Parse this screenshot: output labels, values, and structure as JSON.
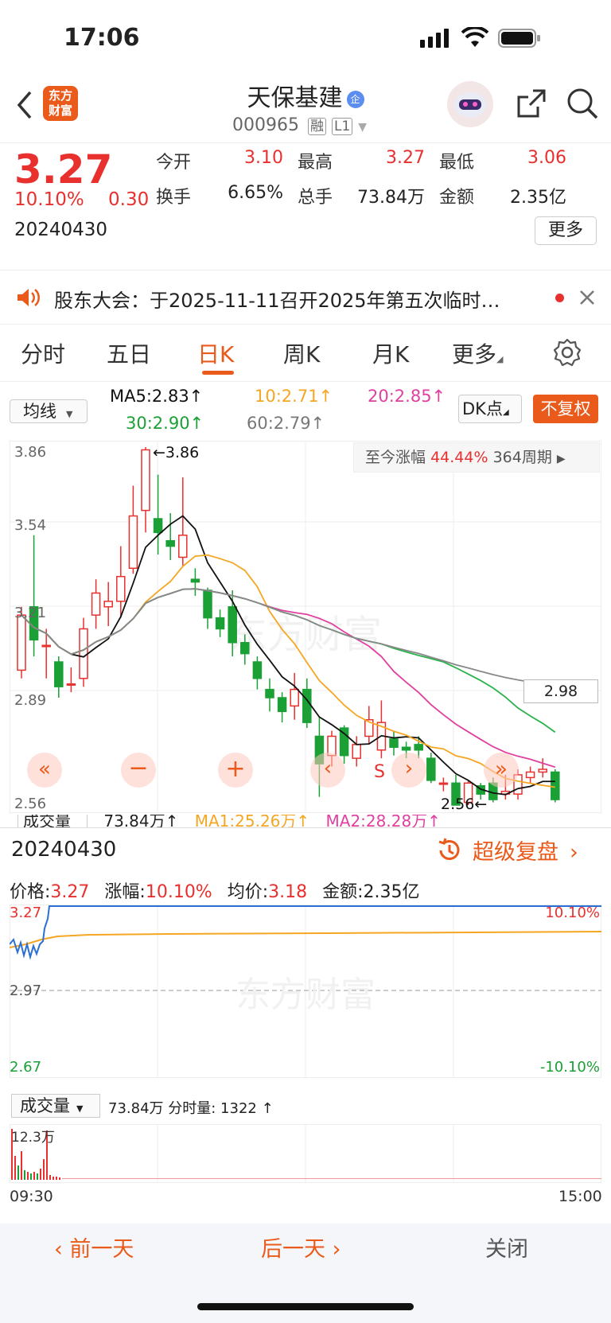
{
  "status": {
    "time": "17:06"
  },
  "header": {
    "logo_text": "东方\n财富",
    "title": "天保基建",
    "code": "000965",
    "badge1": "融",
    "badge2": "L1",
    "title_badge": "企"
  },
  "quote": {
    "price": "3.27",
    "change_pct": "10.10%",
    "change_abs": "0.30",
    "date": "20240430",
    "stats": [
      {
        "label": "今开",
        "value": "3.10",
        "color": "#e8302f"
      },
      {
        "label": "最高",
        "value": "3.27",
        "color": "#e8302f"
      },
      {
        "label": "最低",
        "value": "3.06",
        "color": "#e8302f"
      },
      {
        "label": "换手",
        "value": "6.65%",
        "color": "#222"
      },
      {
        "label": "总手",
        "value": "73.84万",
        "color": "#222"
      },
      {
        "label": "金额",
        "value": "2.35亿",
        "color": "#222"
      }
    ],
    "more_label": "更多"
  },
  "notice": {
    "text": "股东大会：于2025-11-11召开2025年第五次临时…"
  },
  "tabs": [
    "分时",
    "五日",
    "日K",
    "周K",
    "月K",
    "更多"
  ],
  "active_tab": "日K",
  "ma_row": {
    "selector": "均线",
    "ma5": "MA5:2.83↑",
    "ma10": "10:2.71↑",
    "ma20": "20:2.85↑",
    "ma30": "30:2.90↑",
    "ma60": "60:2.79↑",
    "dk_label": "DK点",
    "fq_label": "不复权"
  },
  "kchart": {
    "y_labels": [
      "3.86",
      "3.54",
      "3.21",
      "2.89",
      "2.56"
    ],
    "high_label": "←3.86",
    "low_label": "2.56←",
    "range_label": "至今涨幅",
    "range_pct": "44.44%",
    "range_period": "364周期",
    "price_tag": "2.98",
    "s_marker": "S",
    "vol_label": "成交量",
    "vol_value": "73.84万↑",
    "vol_ma1": "MA1:25.26万↑",
    "vol_ma2": "MA2:28.28万↑",
    "watermark": "东方财富",
    "colors": {
      "up": "#e8302f",
      "down": "#1aa035",
      "ma5": "#111111",
      "ma10": "#f5a623",
      "ma20": "#e040a0",
      "ma30": "#2bb24c",
      "ma60": "#888888"
    },
    "ylim": [
      2.56,
      3.86
    ]
  },
  "chart_data": {
    "type": "candlestick",
    "ylim": [
      2.56,
      3.86
    ],
    "candles": [
      {
        "o": 3.05,
        "c": 3.25,
        "h": 3.28,
        "l": 3.02
      },
      {
        "o": 3.28,
        "c": 3.16,
        "h": 3.54,
        "l": 3.1
      },
      {
        "o": 3.14,
        "c": 3.14,
        "h": 3.2,
        "l": 3.02
      },
      {
        "o": 3.08,
        "c": 2.99,
        "h": 3.1,
        "l": 2.95
      },
      {
        "o": 3.0,
        "c": 3.0,
        "h": 3.06,
        "l": 2.97
      },
      {
        "o": 3.02,
        "c": 3.2,
        "h": 3.24,
        "l": 2.99
      },
      {
        "o": 3.25,
        "c": 3.33,
        "h": 3.38,
        "l": 3.2
      },
      {
        "o": 3.28,
        "c": 3.3,
        "h": 3.37,
        "l": 3.21
      },
      {
        "o": 3.3,
        "c": 3.39,
        "h": 3.5,
        "l": 3.24
      },
      {
        "o": 3.42,
        "c": 3.61,
        "h": 3.72,
        "l": 3.4
      },
      {
        "o": 3.63,
        "c": 3.85,
        "h": 3.86,
        "l": 3.55
      },
      {
        "o": 3.6,
        "c": 3.55,
        "h": 3.76,
        "l": 3.47
      },
      {
        "o": 3.52,
        "c": 3.5,
        "h": 3.62,
        "l": 3.45
      },
      {
        "o": 3.46,
        "c": 3.54,
        "h": 3.75,
        "l": 3.43
      },
      {
        "o": 3.38,
        "c": 3.37,
        "h": 3.42,
        "l": 3.32
      },
      {
        "o": 3.34,
        "c": 3.24,
        "h": 3.35,
        "l": 3.2
      },
      {
        "o": 3.24,
        "c": 3.2,
        "h": 3.27,
        "l": 3.17
      },
      {
        "o": 3.28,
        "c": 3.15,
        "h": 3.34,
        "l": 3.1
      },
      {
        "o": 3.15,
        "c": 3.11,
        "h": 3.18,
        "l": 3.07
      },
      {
        "o": 3.08,
        "c": 3.02,
        "h": 3.1,
        "l": 2.98
      },
      {
        "o": 2.98,
        "c": 2.95,
        "h": 3.02,
        "l": 2.9
      },
      {
        "o": 2.95,
        "c": 2.9,
        "h": 2.97,
        "l": 2.86
      },
      {
        "o": 2.92,
        "c": 2.98,
        "h": 3.04,
        "l": 2.87
      },
      {
        "o": 2.98,
        "c": 2.86,
        "h": 3.02,
        "l": 2.84
      },
      {
        "o": 2.81,
        "c": 2.71,
        "h": 2.88,
        "l": 2.59
      },
      {
        "o": 2.74,
        "c": 2.81,
        "h": 2.83,
        "l": 2.7
      },
      {
        "o": 2.84,
        "c": 2.74,
        "h": 2.85,
        "l": 2.71
      },
      {
        "o": 2.73,
        "c": 2.78,
        "h": 2.81,
        "l": 2.7
      },
      {
        "o": 2.81,
        "c": 2.87,
        "h": 2.92,
        "l": 2.78
      },
      {
        "o": 2.76,
        "c": 2.86,
        "h": 2.94,
        "l": 2.73
      },
      {
        "o": 2.8,
        "c": 2.77,
        "h": 2.83,
        "l": 2.74
      },
      {
        "o": 2.77,
        "c": 2.76,
        "h": 2.79,
        "l": 2.73
      },
      {
        "o": 2.78,
        "c": 2.76,
        "h": 2.81,
        "l": 2.73
      },
      {
        "o": 2.73,
        "c": 2.65,
        "h": 2.75,
        "l": 2.64
      },
      {
        "o": 2.64,
        "c": 2.64,
        "h": 2.66,
        "l": 2.61
      },
      {
        "o": 2.64,
        "c": 2.56,
        "h": 2.67,
        "l": 2.56
      },
      {
        "o": 2.57,
        "c": 2.64,
        "h": 2.65,
        "l": 2.56
      },
      {
        "o": 2.63,
        "c": 2.6,
        "h": 2.64,
        "l": 2.58
      },
      {
        "o": 2.64,
        "c": 2.58,
        "h": 2.66,
        "l": 2.57
      },
      {
        "o": 2.6,
        "c": 2.61,
        "h": 2.67,
        "l": 2.58
      },
      {
        "o": 2.6,
        "c": 2.67,
        "h": 2.69,
        "l": 2.58
      },
      {
        "o": 2.66,
        "c": 2.68,
        "h": 2.7,
        "l": 2.64
      },
      {
        "o": 2.68,
        "c": 2.69,
        "h": 2.73,
        "l": 2.66
      },
      {
        "o": 2.68,
        "c": 2.58,
        "h": 2.69,
        "l": 2.57
      }
    ]
  },
  "popup": {
    "date": "20240430",
    "replay_label": "超级复盘",
    "price_label": "价格:",
    "price": "3.27",
    "chg_label": "涨幅:",
    "chg": "10.10%",
    "avg_label": "均价:",
    "avg": "3.18",
    "amt_label": "金额:2.35亿",
    "y_top": "3.27",
    "y_mid": "2.97",
    "y_bot": "2.67",
    "pct_top": "10.10%",
    "pct_bot": "-10.10%",
    "vol_selector": "成交量",
    "vol_info": "73.84万 分时量: 1322 ↑",
    "vol_max": "12.3万",
    "time_start": "09:30",
    "time_end": "15:00",
    "watermark": "东方财富"
  },
  "bottom": {
    "prev": "前一天",
    "next": "后一天",
    "close": "关闭"
  }
}
